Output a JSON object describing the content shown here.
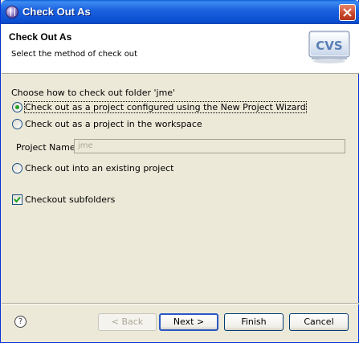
{
  "window": {
    "title": "Check Out As"
  },
  "header": {
    "title": "Check Out As",
    "description": "Select the method of check out",
    "logo_text": "CVS"
  },
  "main": {
    "prompt": "Choose how to check out folder 'jme'",
    "options": [
      {
        "label": "Check out as a project configured using the New Project Wizard",
        "selected": true
      },
      {
        "label": "Check out as a project in the workspace",
        "selected": false
      },
      {
        "label": "Check out into an existing project",
        "selected": false
      }
    ],
    "project_name_label": "Project Name:",
    "project_name_value": "jme",
    "checkout_subfolders_label": "Checkout subfolders",
    "checkout_subfolders_checked": true
  },
  "footer": {
    "help_label": "?",
    "back_label": "< Back",
    "next_label": "Next >",
    "finish_label": "Finish",
    "cancel_label": "Cancel"
  },
  "colors": {
    "titlebar": "#0b4fd0",
    "dialog_bg": "#ece9d8",
    "radio_dot": "#21a121",
    "default_button_border": "#2a57c5"
  }
}
